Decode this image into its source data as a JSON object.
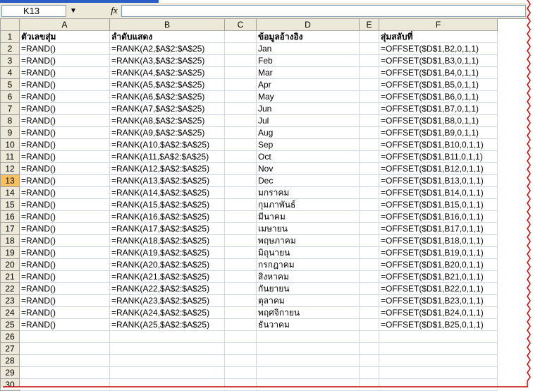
{
  "name_box": {
    "value": "K13",
    "dropdown_icon": "chevron-down-icon"
  },
  "formula_bar": {
    "fx_label": "fx",
    "value": ""
  },
  "columns": [
    "A",
    "B",
    "C",
    "D",
    "E",
    "F"
  ],
  "active_row": 13,
  "header_row": {
    "A": "ตัวเลขสุ่ม",
    "B": "ลำดับแสดง",
    "C": "",
    "D": "ข้อมูลอ้างอิง",
    "E": "",
    "F": "สุ่มสลับที่"
  },
  "rows": [
    {
      "r": 2,
      "A": "=RAND()",
      "B": "=RANK(A2,$A$2:$A$25)",
      "D": "Jan",
      "F": "=OFFSET($D$1,B2,0,1,1)"
    },
    {
      "r": 3,
      "A": "=RAND()",
      "B": "=RANK(A3,$A$2:$A$25)",
      "D": "Feb",
      "F": "=OFFSET($D$1,B3,0,1,1)"
    },
    {
      "r": 4,
      "A": "=RAND()",
      "B": "=RANK(A4,$A$2:$A$25)",
      "D": "Mar",
      "F": "=OFFSET($D$1,B4,0,1,1)"
    },
    {
      "r": 5,
      "A": "=RAND()",
      "B": "=RANK(A5,$A$2:$A$25)",
      "D": "Apr",
      "F": "=OFFSET($D$1,B5,0,1,1)"
    },
    {
      "r": 6,
      "A": "=RAND()",
      "B": "=RANK(A6,$A$2:$A$25)",
      "D": "May",
      "F": "=OFFSET($D$1,B6,0,1,1)"
    },
    {
      "r": 7,
      "A": "=RAND()",
      "B": "=RANK(A7,$A$2:$A$25)",
      "D": "Jun",
      "F": "=OFFSET($D$1,B7,0,1,1)"
    },
    {
      "r": 8,
      "A": "=RAND()",
      "B": "=RANK(A8,$A$2:$A$25)",
      "D": "Jul",
      "F": "=OFFSET($D$1,B8,0,1,1)"
    },
    {
      "r": 9,
      "A": "=RAND()",
      "B": "=RANK(A9,$A$2:$A$25)",
      "D": "Aug",
      "F": "=OFFSET($D$1,B9,0,1,1)"
    },
    {
      "r": 10,
      "A": "=RAND()",
      "B": "=RANK(A10,$A$2:$A$25)",
      "D": "Sep",
      "F": "=OFFSET($D$1,B10,0,1,1)"
    },
    {
      "r": 11,
      "A": "=RAND()",
      "B": "=RANK(A11,$A$2:$A$25)",
      "D": "Oct",
      "F": "=OFFSET($D$1,B11,0,1,1)"
    },
    {
      "r": 12,
      "A": "=RAND()",
      "B": "=RANK(A12,$A$2:$A$25)",
      "D": "Nov",
      "F": "=OFFSET($D$1,B12,0,1,1)"
    },
    {
      "r": 13,
      "A": "=RAND()",
      "B": "=RANK(A13,$A$2:$A$25)",
      "D": "Dec",
      "F": "=OFFSET($D$1,B13,0,1,1)"
    },
    {
      "r": 14,
      "A": "=RAND()",
      "B": "=RANK(A14,$A$2:$A$25)",
      "D": "มกราคม",
      "F": "=OFFSET($D$1,B14,0,1,1)"
    },
    {
      "r": 15,
      "A": "=RAND()",
      "B": "=RANK(A15,$A$2:$A$25)",
      "D": "กุมภาพันธ์",
      "F": "=OFFSET($D$1,B15,0,1,1)"
    },
    {
      "r": 16,
      "A": "=RAND()",
      "B": "=RANK(A16,$A$2:$A$25)",
      "D": "มีนาคม",
      "F": "=OFFSET($D$1,B16,0,1,1)"
    },
    {
      "r": 17,
      "A": "=RAND()",
      "B": "=RANK(A17,$A$2:$A$25)",
      "D": "เมษายน",
      "F": "=OFFSET($D$1,B17,0,1,1)"
    },
    {
      "r": 18,
      "A": "=RAND()",
      "B": "=RANK(A18,$A$2:$A$25)",
      "D": "พฤษภาคม",
      "F": "=OFFSET($D$1,B18,0,1,1)"
    },
    {
      "r": 19,
      "A": "=RAND()",
      "B": "=RANK(A19,$A$2:$A$25)",
      "D": "มิถุนายน",
      "F": "=OFFSET($D$1,B19,0,1,1)"
    },
    {
      "r": 20,
      "A": "=RAND()",
      "B": "=RANK(A20,$A$2:$A$25)",
      "D": "กรกฎาคม",
      "F": "=OFFSET($D$1,B20,0,1,1)"
    },
    {
      "r": 21,
      "A": "=RAND()",
      "B": "=RANK(A21,$A$2:$A$25)",
      "D": "สิงหาคม",
      "F": "=OFFSET($D$1,B21,0,1,1)"
    },
    {
      "r": 22,
      "A": "=RAND()",
      "B": "=RANK(A22,$A$2:$A$25)",
      "D": "กันยายน",
      "F": "=OFFSET($D$1,B22,0,1,1)"
    },
    {
      "r": 23,
      "A": "=RAND()",
      "B": "=RANK(A23,$A$2:$A$25)",
      "D": "ตุลาคม",
      "F": "=OFFSET($D$1,B23,0,1,1)"
    },
    {
      "r": 24,
      "A": "=RAND()",
      "B": "=RANK(A24,$A$2:$A$25)",
      "D": "พฤศจิกายน",
      "F": "=OFFSET($D$1,B24,0,1,1)"
    },
    {
      "r": 25,
      "A": "=RAND()",
      "B": "=RANK(A25,$A$2:$A$25)",
      "D": "ธันวาคม",
      "F": "=OFFSET($D$1,B25,0,1,1)"
    },
    {
      "r": 26
    },
    {
      "r": 27
    },
    {
      "r": 28
    },
    {
      "r": 29
    },
    {
      "r": 30
    }
  ],
  "colors": {
    "header_bg": "#ece9d8",
    "active_row_header": "#f8c060",
    "gridline": "#d0d7e5",
    "torn_edge": "#cc0000"
  }
}
